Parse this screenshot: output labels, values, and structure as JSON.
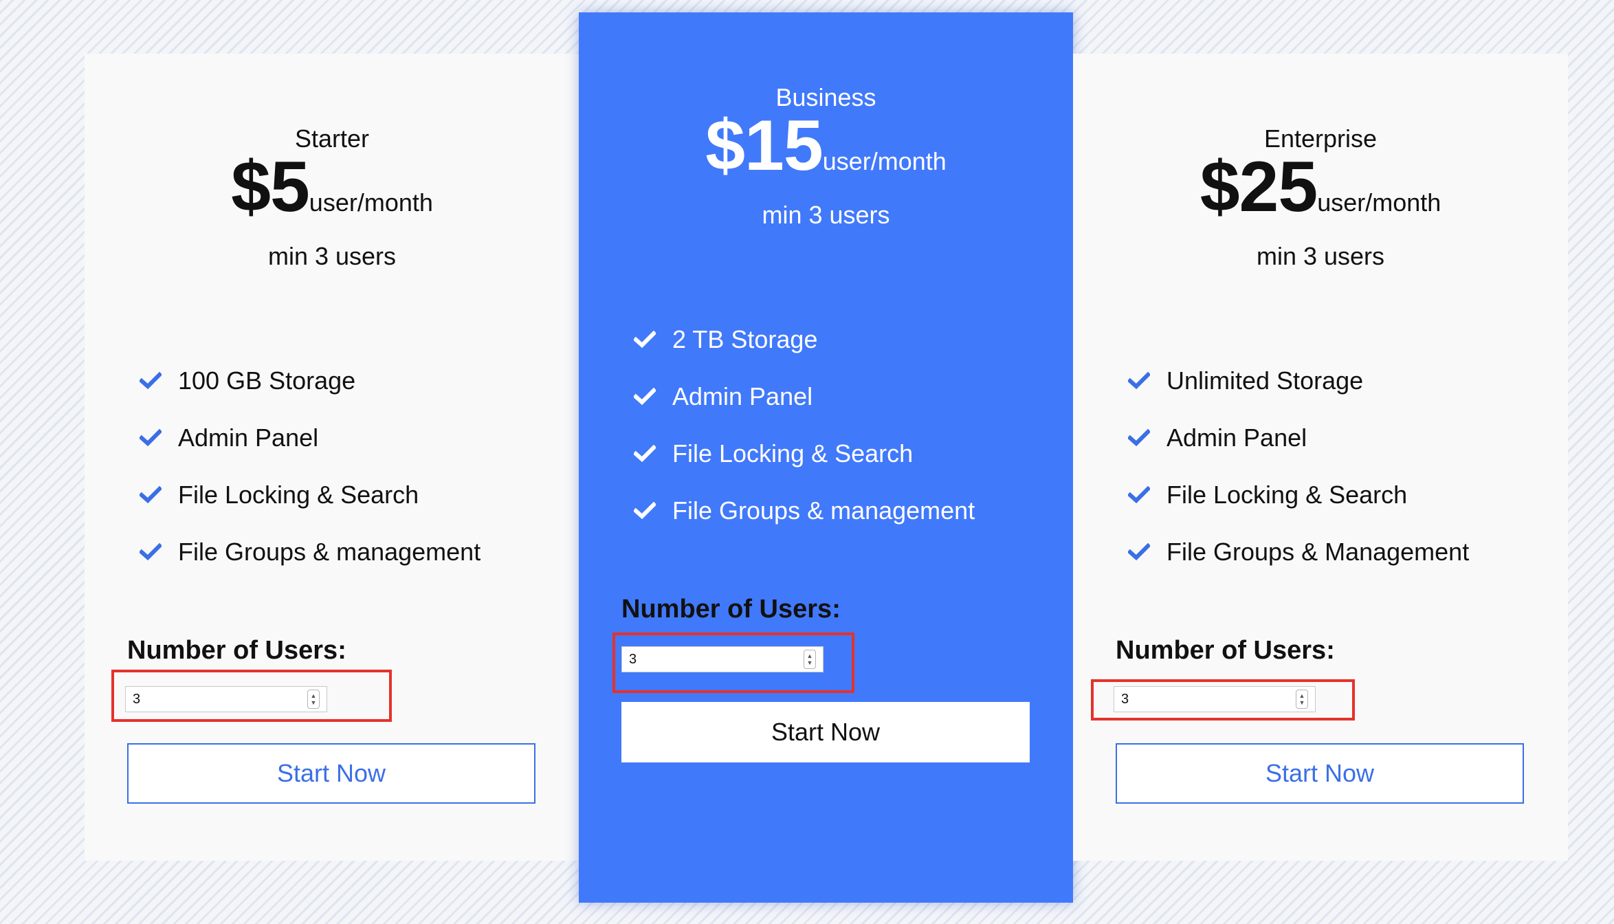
{
  "plans": [
    {
      "name": "Starter",
      "price": "$5",
      "unit": "user/month",
      "min_users": "min 3 users",
      "features": [
        "100 GB Storage",
        "Admin Panel",
        "File Locking & Search",
        "File Groups & management"
      ],
      "users_label": "Number of Users:",
      "users_value": "3",
      "button": "Start Now"
    },
    {
      "name": "Business",
      "price": "$15",
      "unit": "user/month",
      "min_users": "min 3 users",
      "features": [
        "2 TB Storage",
        "Admin Panel",
        "File Locking & Search",
        "File Groups & management"
      ],
      "users_label": "Number of Users:",
      "users_value": "3",
      "button": "Start Now"
    },
    {
      "name": "Enterprise",
      "price": "$25",
      "unit": "user/month",
      "min_users": "min 3 users",
      "features": [
        "Unlimited Storage",
        "Admin Panel",
        "File Locking & Search",
        "File Groups & Management"
      ],
      "users_label": "Number of Users:",
      "users_value": "3",
      "button": "Start Now"
    }
  ],
  "icons": {
    "feature": "check-icon",
    "stepper": "spinner-arrows-icon"
  },
  "colors": {
    "accent": "#4179fb",
    "button_border": "#3b6fe6",
    "check_starter": "#3b6fe6",
    "check_business": "#ffffff",
    "highlight": "#e5322b",
    "card_bg": "#f9f9f9"
  }
}
